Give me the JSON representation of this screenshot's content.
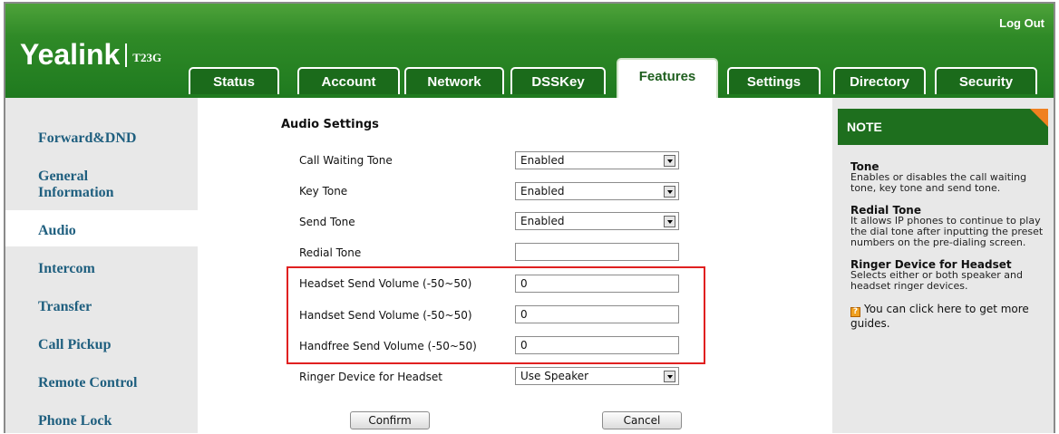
{
  "header": {
    "logout": "Log Out",
    "brand": "Yealink",
    "model": "T23G"
  },
  "tabs": [
    {
      "label": "Status",
      "active": false
    },
    {
      "label": "Account",
      "active": false
    },
    {
      "label": "Network",
      "active": false
    },
    {
      "label": "DSSKey",
      "active": false
    },
    {
      "label": "Features",
      "active": true
    },
    {
      "label": "Settings",
      "active": false
    },
    {
      "label": "Directory",
      "active": false
    },
    {
      "label": "Security",
      "active": false
    }
  ],
  "sidebar": {
    "items": [
      {
        "label": "Forward&DND"
      },
      {
        "label": "General Information"
      },
      {
        "label": "Audio",
        "active": true
      },
      {
        "label": "Intercom"
      },
      {
        "label": "Transfer"
      },
      {
        "label": "Call Pickup"
      },
      {
        "label": "Remote Control"
      },
      {
        "label": "Phone Lock"
      }
    ]
  },
  "main": {
    "section_title": "Audio Settings",
    "rows": [
      {
        "label": "Call Waiting Tone",
        "value": "Enabled",
        "type": "select"
      },
      {
        "label": "Key Tone",
        "value": "Enabled",
        "type": "select"
      },
      {
        "label": "Send Tone",
        "value": "Enabled",
        "type": "select"
      },
      {
        "label": "Redial Tone",
        "value": "",
        "type": "input"
      },
      {
        "label": "Headset Send Volume (-50~50)",
        "value": "0",
        "type": "input"
      },
      {
        "label": "Handset Send Volume (-50~50)",
        "value": "0",
        "type": "input"
      },
      {
        "label": "Handfree Send Volume (-50~50)",
        "value": "0",
        "type": "input"
      },
      {
        "label": "Ringer Device for Headset",
        "value": "Use Speaker",
        "type": "select"
      }
    ],
    "confirm_label": "Confirm",
    "cancel_label": "Cancel"
  },
  "note": {
    "title": "NOTE",
    "sections": [
      {
        "title": "Tone",
        "text": "Enables or disables the call waiting tone, key tone and send tone."
      },
      {
        "title": "Redial Tone",
        "text": "It allows IP phones to continue to play the dial tone after inputting the preset numbers on the pre-dialing screen."
      },
      {
        "title": "Ringer Device for Headset",
        "text": "Selects either or both speaker and headset ringer devices."
      }
    ],
    "guide_text": "You can click here to get more guides."
  },
  "colors": {
    "header_green": "#2f8a27",
    "active_tab_text": "#1f5f1f",
    "sidebar_link": "#1f5f7f",
    "highlight": "#e02020",
    "note_corner": "#f08020"
  }
}
